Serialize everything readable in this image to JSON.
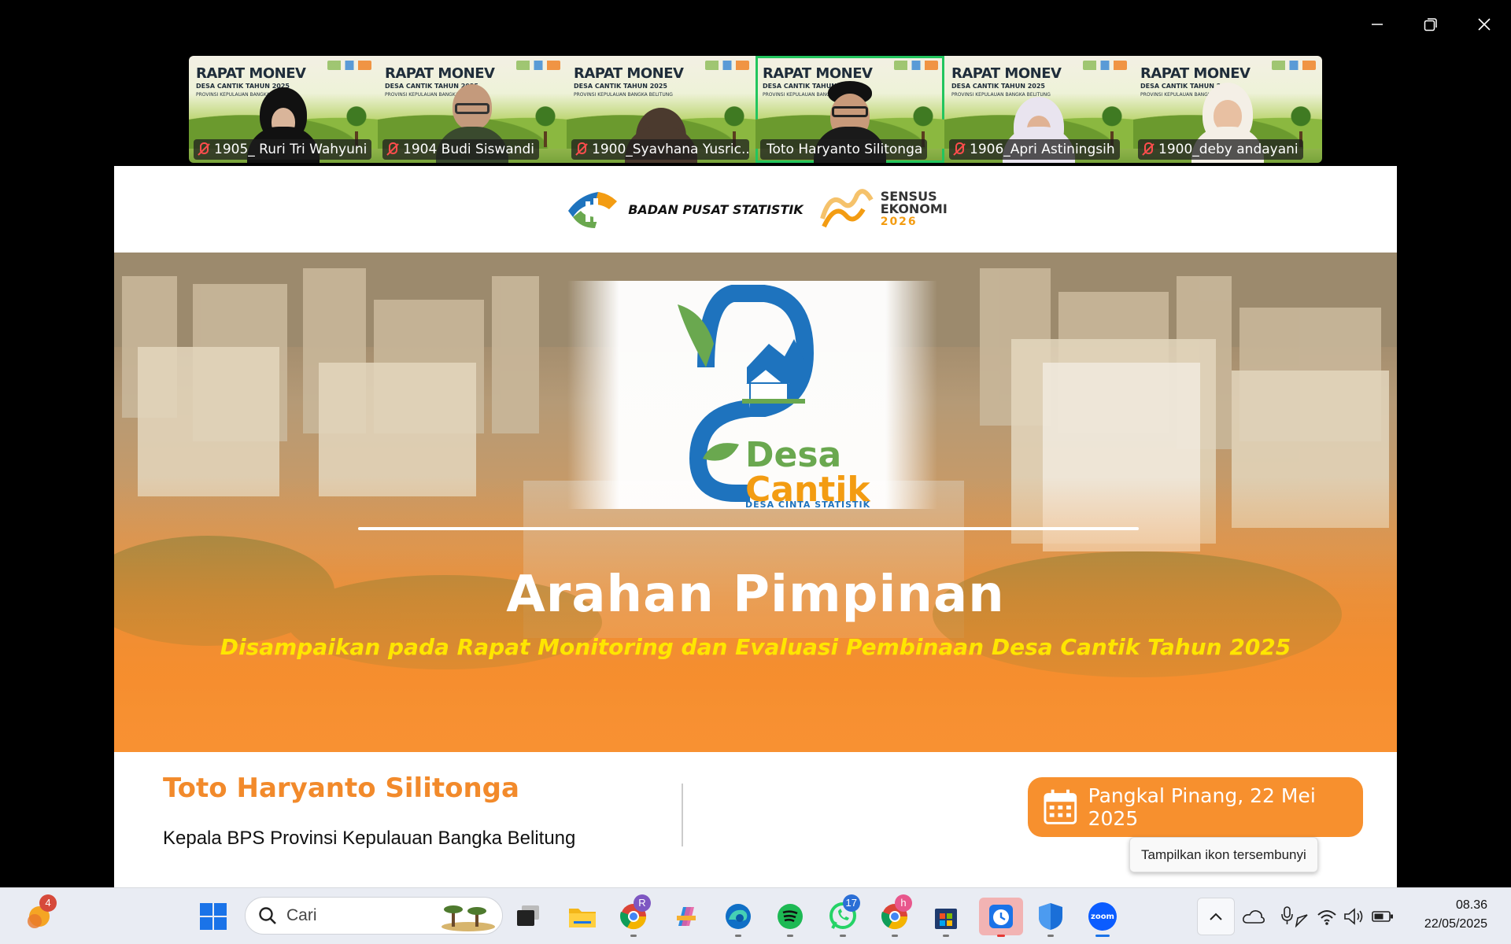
{
  "window_controls": {
    "minimize": "minimize",
    "restore": "restore",
    "close": "close"
  },
  "participants": [
    {
      "name": "1905_ Ruri Tri Wahyuni",
      "muted": true,
      "banner": "RAPAT MONEV",
      "banner_sub": "DESA CANTIK TAHUN 2025",
      "banner_sub2": "PROVINSI KEPULAUAN BANGKA BELITUNG"
    },
    {
      "name": "1904 Budi Siswandi",
      "muted": true,
      "banner": "RAPAT MONEV",
      "banner_sub": "DESA CANTIK TAHUN 2025",
      "banner_sub2": "PROVINSI KEPULAUAN BANGKA BELITUNG"
    },
    {
      "name": "1900_Syavhana Yusric...",
      "muted": true,
      "banner": "RAPAT MONEV",
      "banner_sub": "DESA CANTIK TAHUN 2025",
      "banner_sub2": "PROVINSI KEPULAUAN BANGKA BELITUNG"
    },
    {
      "name": "Toto Haryanto Silitonga",
      "muted": false,
      "active": true,
      "banner": "RAPAT MONEV",
      "banner_sub": "DESA CANTIK TAHUN 2025",
      "banner_sub2": "PROVINSI KEPULAUAN BANGKA BELITUNG"
    },
    {
      "name": "1906_Apri Astiningsih",
      "muted": true,
      "banner": "RAPAT MONEV",
      "banner_sub": "DESA CANTIK TAHUN 2025",
      "banner_sub2": "PROVINSI KEPULAUAN BANGKA BELITUNG"
    },
    {
      "name": "1900_deby andayani",
      "muted": true,
      "banner": "RAPAT MONEV",
      "banner_sub": "DESA CANTIK TAHUN 2025",
      "banner_sub2": "PROVINSI KEPULAUAN BANGKA BELITUNG"
    }
  ],
  "slide": {
    "org_name": "BADAN PUSAT STATISTIK",
    "census_line1": "SENSUS",
    "census_line2": "EKONOMI",
    "census_year": "2026",
    "logo_word1": "Desa",
    "logo_word2": "Cantik",
    "logo_tagline": "DESA CINTA STATISTIK",
    "title": "Arahan Pimpinan",
    "subtitle": "Disampaikan pada Rapat Monitoring dan Evaluasi Pembinaan Desa Cantik Tahun 2025",
    "presenter": "Toto Haryanto Silitonga",
    "role": "Kepala BPS Provinsi Kepulauan Bangka Belitung",
    "date_place": "Pangkal Pinang, 22 Mei 2025"
  },
  "tooltip": "Tampilkan ikon tersembunyi",
  "taskbar": {
    "weather_badge": "4",
    "search_placeholder": "Cari",
    "whatsapp_badge": "17",
    "chrome_profile_1": "R",
    "chrome_profile_2": "h",
    "zoom_label": "zoom",
    "time": "08.36",
    "date": "22/05/2025"
  },
  "colors": {
    "accent_orange": "#f7902e",
    "subtitle_yellow": "#ffe600",
    "active_tile": "#22c55e",
    "logo_blue": "#1e73be",
    "logo_green": "#6aa84f"
  }
}
